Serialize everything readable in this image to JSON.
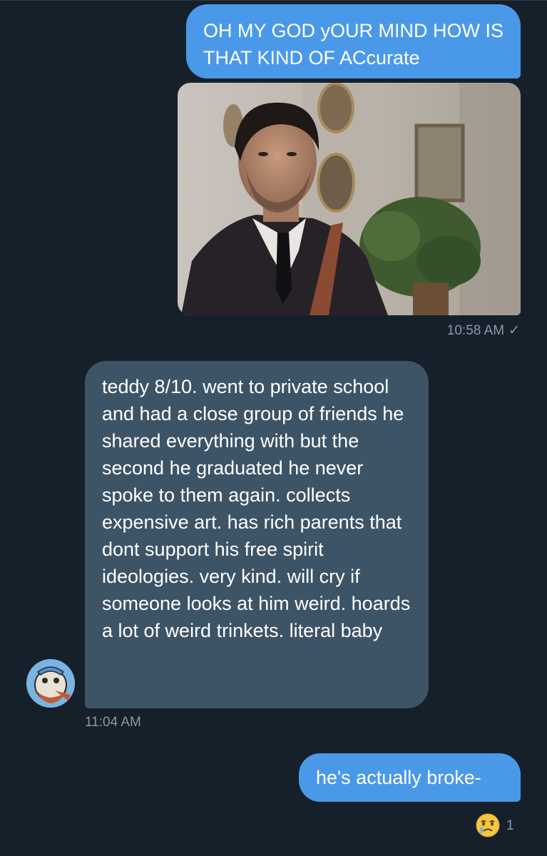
{
  "conversation": {
    "messages": [
      {
        "from": "me",
        "text": "OH MY GOD yOUR MIND HOW IS THAT KIND OF ACcurate"
      },
      {
        "from": "me",
        "type": "photo"
      },
      {
        "from": "them",
        "text": "teddy 8/10. went to private school and had a close group of friends he shared everything with but the second he graduated he never spoke to them again. collects expensive art. has rich parents that dont support his free spirit ideologies. very kind. will cry if someone looks at him weird. hoards a lot of weird trinkets. literal baby"
      },
      {
        "from": "me",
        "text": "he's actually broke-"
      }
    ],
    "timestamps": {
      "sent": "10:58 AM",
      "received": "11:04 AM"
    },
    "reaction": {
      "emoji": "crying-face",
      "count": "1"
    }
  },
  "colors": {
    "background": "#15202b",
    "outgoing_bubble": "#4a99e9",
    "incoming_bubble": "#3d5466",
    "meta_text": "#8899a6"
  },
  "icons": {
    "delivered": "checkmark-icon",
    "reaction": "crying-face-icon"
  }
}
